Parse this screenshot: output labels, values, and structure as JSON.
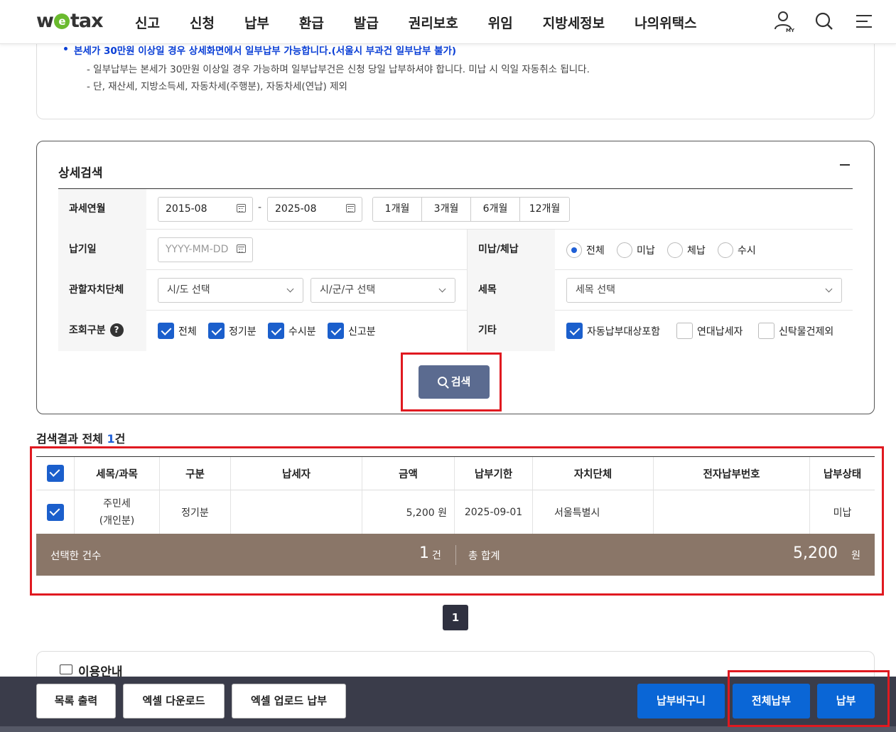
{
  "header": {
    "logo": "wetax",
    "nav": [
      "신고",
      "신청",
      "납부",
      "환급",
      "발급",
      "권리보호",
      "위임",
      "지방세정보",
      "나의위택스"
    ],
    "icons": [
      "my-page-icon",
      "search-icon",
      "menu-icon"
    ],
    "my_label": "MY"
  },
  "notice": {
    "bullet": "본세가 30만원 이상일 경우 상세화면에서 일부납부 가능합니다.(서울시 부과건 일부납부 불가)",
    "line2": "- 일부납부는 본세가 30만원 이상일 경우 가능하며 일부납부건은 신청 당일 납부하셔야 합니다. 미납 시 익일 자동취소 됩니다.",
    "line3": "- 단, 재산세, 지방소득세, 자동차세(주행분), 자동차세(연납) 제외"
  },
  "search": {
    "title": "상세검색",
    "tax_period_label": "과세연월",
    "from": "2015-08",
    "to": "2025-08",
    "dash": "-",
    "periods": [
      "1개월",
      "3개월",
      "6개월",
      "12개월"
    ],
    "pay_date_label": "납기일",
    "pay_date_placeholder": "YYYY-MM-DD",
    "unpaid_label": "미납/체납",
    "unpaid_options": [
      "전체",
      "미납",
      "체납",
      "수시"
    ],
    "unpaid_selected": "전체",
    "region_label": "관할자치단체",
    "sido_placeholder": "시/도 선택",
    "sigungu_placeholder": "시/군/구 선택",
    "tax_item_label": "세목",
    "tax_item_placeholder": "세목 선택",
    "query_label": "조회구분",
    "query_options": [
      "전체",
      "정기분",
      "수시분",
      "신고분"
    ],
    "etc_label": "기타",
    "etc_options": [
      "자동납부대상포함",
      "연대납세자",
      "신탁물건제외"
    ],
    "etc_checked": [
      true,
      false,
      false
    ],
    "search_button": "검색"
  },
  "results": {
    "title_prefix": "검색결과 전체",
    "count": "1",
    "count_suffix": "건",
    "columns": [
      "세목/과목",
      "구분",
      "납세자",
      "금액",
      "납부기한",
      "자치단체",
      "전자납부번호",
      "납부상태"
    ],
    "rows": [
      {
        "tax_line1": "주민세",
        "tax_line2": "(개인분)",
        "type": "정기분",
        "taxpayer": "",
        "amount": "5,200 원",
        "due": "2025-09-01",
        "local_gov": "서울특별시",
        "epay_no": "",
        "status": "미납"
      }
    ],
    "selected_label": "선택한 건수",
    "selected_count": "1",
    "selected_unit": "건",
    "total_label": "총 합계",
    "total_amount": "5,200",
    "total_unit": "원",
    "page": "1"
  },
  "guide": {
    "title": "이용안내"
  },
  "bottom": {
    "left_buttons": [
      "목록 출력",
      "엑셀 다운로드",
      "엑셀 업로드 납부"
    ],
    "right_buttons": [
      "납부바구니",
      "전체납부",
      "납부"
    ]
  },
  "colors": {
    "accent_blue": "#0a66d6",
    "total_bar": "#8a7668",
    "search_button": "#5b6b90",
    "highlight_red": "#e01920"
  }
}
